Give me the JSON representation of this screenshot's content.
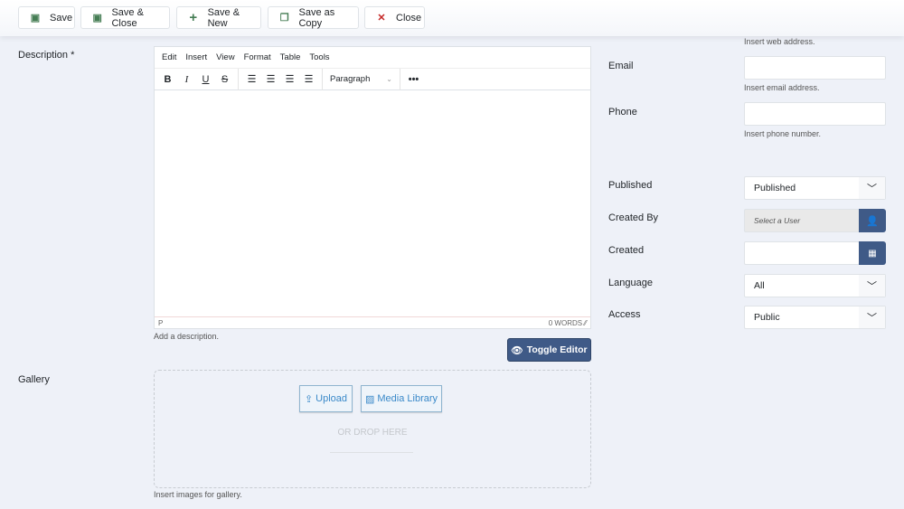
{
  "toolbar": {
    "save": "Save",
    "save_close": "Save & Close",
    "save_new": "Save & New",
    "save_copy": "Save as Copy",
    "close": "Close"
  },
  "description": {
    "label": "Description *",
    "menu": [
      "Edit",
      "Insert",
      "View",
      "Format",
      "Table",
      "Tools"
    ],
    "block_format": "Paragraph",
    "status_path": "P",
    "word_count": "0 WORDS",
    "hint": "Add a description.",
    "toggle": "Toggle Editor"
  },
  "gallery": {
    "label": "Gallery",
    "upload": "Upload",
    "media_library": "Media Library",
    "drop_text": "OR DROP HERE",
    "hint": "Insert images for gallery."
  },
  "right": {
    "web_hint": "Insert web address.",
    "email": {
      "label": "Email",
      "value": "",
      "hint": "Insert email address."
    },
    "phone": {
      "label": "Phone",
      "value": "",
      "hint": "Insert phone number."
    },
    "published": {
      "label": "Published",
      "value": "Published"
    },
    "created_by": {
      "label": "Created By",
      "placeholder": "Select a User"
    },
    "created": {
      "label": "Created",
      "value": ""
    },
    "language": {
      "label": "Language",
      "value": "All"
    },
    "access": {
      "label": "Access",
      "value": "Public"
    }
  },
  "colors": {
    "primary": "#3f5a87",
    "save_icon": "#457d54",
    "close_icon": "#c52827",
    "media": "#3a89c9"
  }
}
